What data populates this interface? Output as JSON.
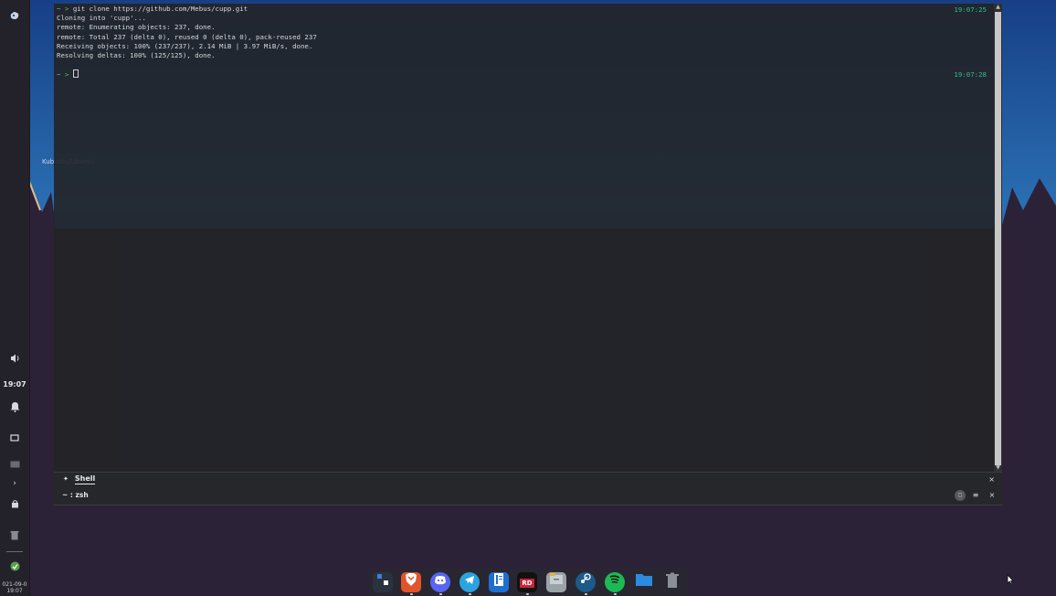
{
  "terminal": {
    "command_line": {
      "prompt_tilde": "~",
      "prompt_arrow": ">",
      "command": "git clone https://github.com/Mebus/cupp.git",
      "timestamp": "19:07:25"
    },
    "output_lines": [
      "Cloning into 'cupp'...",
      "remote: Enumerating objects: 237, done.",
      "remote: Total 237 (delta 0), reused 0 (delta 0), pack-reused 237",
      "Receiving objects: 100% (237/237), 2.14 MiB | 3.97 MiB/s, done.",
      "Resolving deltas: 100% (125/125), done."
    ],
    "current_prompt": {
      "prompt_tilde": "~",
      "prompt_arrow": ">",
      "timestamp": "19:07:28"
    },
    "tab": {
      "label": "Shell",
      "close": "×"
    },
    "status": {
      "text": "~ : zsh",
      "close": "×",
      "menu": "≡"
    }
  },
  "panel": {
    "clock": "19:07",
    "date": "021-09-0",
    "date_time": "19:07"
  },
  "desktop": {
    "icon_label": "Kubuntu/Ubuntu"
  },
  "dock": {
    "items": [
      {
        "name": "workspace-switcher",
        "color": "#3b7fd6"
      },
      {
        "name": "brave-browser",
        "color": "#e0542a"
      },
      {
        "name": "discord",
        "color": "#5865f2"
      },
      {
        "name": "telegram",
        "color": "#2aa3df"
      },
      {
        "name": "notes",
        "color": "#1f6fd1"
      },
      {
        "name": "rider",
        "color": "#c7243a",
        "label": "RD"
      },
      {
        "name": "file-manager",
        "color": "#9aa3a8"
      },
      {
        "name": "steam",
        "color": "#1b5a8a"
      },
      {
        "name": "spotify",
        "color": "#1db954"
      },
      {
        "name": "folder",
        "color": "#2b8be0"
      },
      {
        "name": "trash",
        "color": "#8a8f95"
      }
    ]
  }
}
